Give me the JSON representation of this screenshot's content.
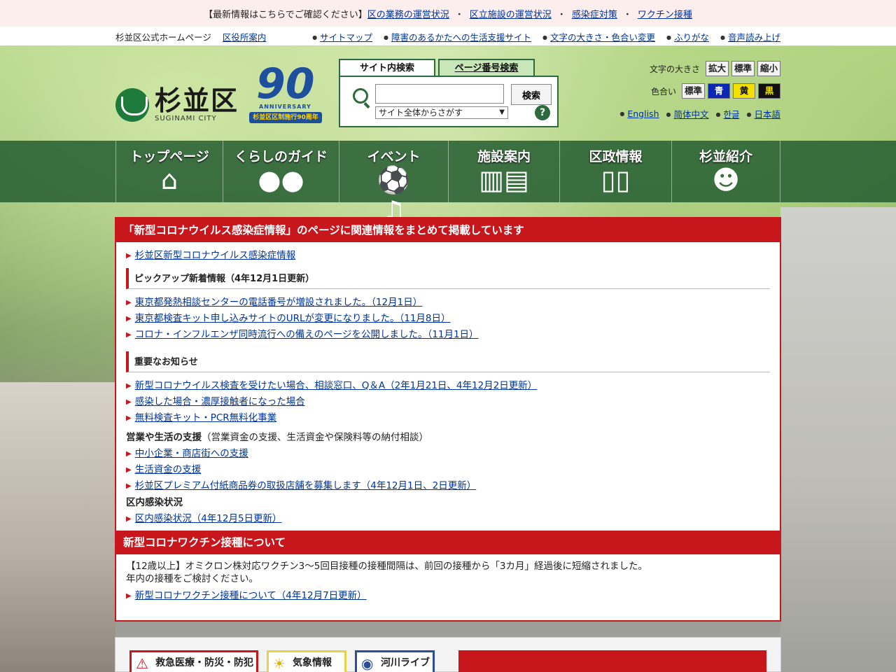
{
  "alert_bar": {
    "lead": "【最新情報はこちらでご確認ください】",
    "links": [
      "区の業務の運営状況",
      "区立施設の運営状況",
      "感染症対策",
      "ワクチン接種"
    ],
    "separator": "・"
  },
  "util_bar": {
    "site_name": "杉並区公式ホームページ",
    "office_guide": "区役所案内",
    "links": [
      "サイトマップ",
      "障害のあるかたへの生活支援サイト",
      "文字の大きさ・色合い変更",
      "ふりがな",
      "音声読み上げ"
    ]
  },
  "logo": {
    "jp": "杉並区",
    "en": "SUGINAMI CITY"
  },
  "anniversary": {
    "number": "90",
    "label_en": "ANNIVERSARY",
    "label_jp": "杉並区区制施行90周年"
  },
  "search": {
    "tabs": [
      "サイト内検索",
      "ページ番号検索"
    ],
    "button": "検索",
    "input_value": "",
    "scope": "サイト全体からさがす",
    "help": "?"
  },
  "accessibility": {
    "font_size_label": "文字の大きさ",
    "font_size_buttons": [
      "拡大",
      "標準",
      "縮小"
    ],
    "color_label": "色合い",
    "color_buttons": [
      "標準",
      "青",
      "黄",
      "黒"
    ],
    "languages": [
      "English",
      "简体中文",
      "한글",
      "日本語"
    ]
  },
  "global_nav": [
    {
      "label": "トップページ",
      "icon": "house-icon"
    },
    {
      "label": "くらしのガイド",
      "icon": "people-icon"
    },
    {
      "label": "イベント",
      "icon": "soccer-music-icon"
    },
    {
      "label": "施設案内",
      "icon": "buildings-icon"
    },
    {
      "label": "区政情報",
      "icon": "book-icon"
    },
    {
      "label": "杉並紹介",
      "icon": "mascot-icon"
    }
  ],
  "covid_panel": {
    "title": "「新型コロナウイルス感染症情報」のページに関連情報をまとめて掲載しています",
    "top_link": "杉並区新型コロナウイルス感染症情報",
    "pickup": {
      "heading": "ピックアップ新着情報（4年12月1日更新）",
      "links": [
        "東京都発熱相談センターの電話番号が増設されました。（12月1日）",
        "東京都検査キット申し込みサイトのURLが変更になりました。（11月8日）",
        "コロナ・インフルエンザ同時流行への備えのページを公開しました。（11月1日）"
      ]
    },
    "important": {
      "heading": "重要なお知らせ",
      "links": [
        "新型コロナウイルス検査を受けたい場合、相談窓口、Q＆A（2年1月21日、4年12月2日更新）",
        "感染した場合・濃厚接触者になった場合",
        "無料検査キット・PCR無料化事業"
      ]
    },
    "business": {
      "heading": "営業や生活の支援",
      "note": "（営業資金の支援、生活資金や保険料等の納付相談）",
      "links": [
        "中小企業・商店街への支援",
        "生活資金の支援",
        "杉並区プレミアム付紙商品券の取扱店舗を募集します（4年12月1日、2日更新）"
      ]
    },
    "local": {
      "heading": "区内感染状況",
      "links": [
        "区内感染状況（4年12月5日更新）"
      ]
    }
  },
  "vaccine_panel": {
    "title": "新型コロナワクチン接種について",
    "text1": "【12歳以上】オミクロン株対応ワクチン3～5回目接種の接種間隔は、前回の接種から「3カ月」経過後に短縮されました。",
    "text2": "年内の接種をご検討ください。",
    "link": "新型コロナワクチン接種について（4年12月7日更新）"
  },
  "bottom_cards": [
    "救急医療・防災・防犯",
    "気象情報",
    "河川ライブ"
  ],
  "colors": {
    "brand_green": "#2d6b3e",
    "alert_red": "#c8161d",
    "link_blue": "#00339a"
  }
}
